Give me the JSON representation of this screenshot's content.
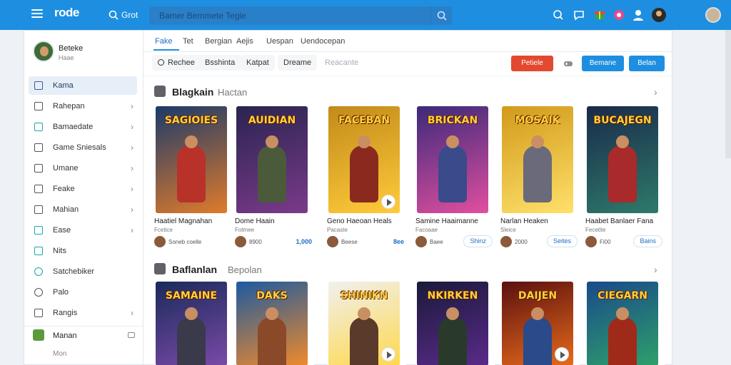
{
  "header": {
    "logo": "rode",
    "logo_sub": "",
    "search_label": "Grot",
    "search_placeholder": "Bamer Bemmete Tegle",
    "colors": {
      "primary": "#1e8fe0",
      "accent_red": "#e2492f"
    }
  },
  "sidebar": {
    "profile_name": "Beteke",
    "profile_sub": "Haae",
    "items": [
      {
        "label": "Kama",
        "icon": "home-icon",
        "chevron": false
      },
      {
        "label": "Rahepan",
        "icon": "crown-icon",
        "chevron": true
      },
      {
        "label": "Bamaedate",
        "icon": "gift-icon",
        "chevron": true
      },
      {
        "label": "Game Sniesals",
        "icon": "grid-icon",
        "chevron": true
      },
      {
        "label": "Umane",
        "icon": "chat-icon",
        "chevron": true
      },
      {
        "label": "Feake",
        "icon": "square-icon",
        "chevron": true
      },
      {
        "label": "Mahian",
        "icon": "camera-icon",
        "chevron": true
      },
      {
        "label": "Ease",
        "icon": "image-icon",
        "chevron": true
      },
      {
        "label": "Nits",
        "icon": "check-icon",
        "chevron": false
      },
      {
        "label": "Satchebiker",
        "icon": "clock-icon",
        "chevron": false
      },
      {
        "label": "Palo",
        "icon": "avatar-icon",
        "chevron": false
      },
      {
        "label": "Rangis",
        "icon": "edit-icon",
        "chevron": true
      }
    ],
    "app_label": "Manan",
    "footer_label": "Mon"
  },
  "tabs": [
    "Fake",
    "Tet",
    "Bergian",
    "Aejis",
    "Uespan",
    "Uendocepan"
  ],
  "filters": [
    {
      "label": "Rechee",
      "icon": true,
      "faded": false
    },
    {
      "label": "Bsshinta",
      "icon": false,
      "faded": false
    },
    {
      "label": "Katpat",
      "icon": false,
      "faded": false
    },
    {
      "label": "Dreame",
      "icon": false,
      "faded": false
    },
    {
      "label": "Reacante",
      "icon": false,
      "faded": true
    }
  ],
  "actions": {
    "primary": "Petiele",
    "secondary": "Bemane",
    "tertiary": "Belan"
  },
  "sections": [
    {
      "title": "Blagkain",
      "subtitle": "Hactan",
      "cards": [
        {
          "art_title": "SAGIOIES",
          "title": "Haatiel Magnahan",
          "sub": "Fcetice",
          "foot": "Soneb coelle",
          "price": "",
          "pill": "",
          "colors": [
            "#1b3a6b",
            "#e07b2a"
          ],
          "hero": "#b8322a",
          "badge": false
        },
        {
          "art_title": "AUIDIAN",
          "title": "Dome Haain",
          "sub": "Fotmee",
          "foot": "8900",
          "price": "1,000",
          "pill": "",
          "colors": [
            "#2a2450",
            "#7a3a8a"
          ],
          "hero": "#4a5a3a",
          "badge": false
        },
        {
          "art_title": "FACEBAN",
          "title": "Geno Haeoan Heals",
          "sub": "Pacaste",
          "foot": "Beese",
          "price": "8ee",
          "pill": "",
          "colors": [
            "#c28a1a",
            "#ffcb3a"
          ],
          "hero": "#8a2a1e",
          "badge": true
        },
        {
          "art_title": "BRICKAN",
          "title": "Samine Haaimanne",
          "sub": "Facoaae",
          "foot": "Baee",
          "price": "",
          "pill": "Shinz",
          "colors": [
            "#3b2a7a",
            "#e14ea0"
          ],
          "hero": "#3a4a8a",
          "badge": false
        },
        {
          "art_title": "MOSAIK",
          "title": "Narlan Heaken",
          "sub": "Sleice",
          "foot": "2000",
          "price": "",
          "pill": "Seites",
          "colors": [
            "#d19a1a",
            "#ffe06a"
          ],
          "hero": "#6a6a7a",
          "badge": false
        },
        {
          "art_title": "BUCAJEGN",
          "title": "Haabet Banlaer Fana",
          "sub": "Fecetite",
          "foot": "Fi00",
          "price": "",
          "pill": "Bains",
          "colors": [
            "#1a2a4a",
            "#2e7a6a"
          ],
          "hero": "#a82a2a",
          "badge": false
        }
      ]
    },
    {
      "title": "Baflanlan",
      "subtitle": "Bepolan",
      "cards": [
        {
          "art_title": "SAMAINE",
          "colors": [
            "#1a2a5a",
            "#7a4aa8"
          ],
          "hero": "#3a3a4a",
          "badge": false
        },
        {
          "art_title": "DAKS",
          "colors": [
            "#1c5aa0",
            "#f08a2a"
          ],
          "hero": "#8a4a2a",
          "badge": false
        },
        {
          "art_title": "SHINIKN",
          "colors": [
            "#f0f0f0",
            "#ffd84a"
          ],
          "hero": "#5a3a2a",
          "badge": true
        },
        {
          "art_title": "NKIRKEN",
          "colors": [
            "#1a1a3a",
            "#5a2a8a"
          ],
          "hero": "#2a3a2a",
          "badge": false
        },
        {
          "art_title": "DAIJEN",
          "colors": [
            "#5a1010",
            "#e86a1a"
          ],
          "hero": "#2a4a8a",
          "badge": true
        },
        {
          "art_title": "CIEGARN",
          "colors": [
            "#1a4a8a",
            "#2ea06a"
          ],
          "hero": "#a02a1a",
          "badge": false
        }
      ]
    }
  ]
}
